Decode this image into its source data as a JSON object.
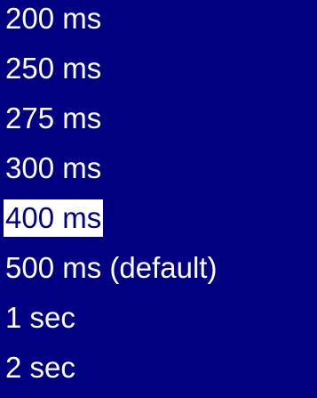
{
  "menu": {
    "colors": {
      "background": "#000080",
      "text": "#ffffff",
      "selected_background": "#ffffff",
      "selected_text": "#000080"
    },
    "selected_value": "400 ms",
    "items": [
      {
        "label": "200 ms"
      },
      {
        "label": "250 ms"
      },
      {
        "label": "275 ms"
      },
      {
        "label": "300 ms"
      },
      {
        "label": "400 ms"
      },
      {
        "label": "500 ms (default)"
      },
      {
        "label": "1 sec"
      },
      {
        "label": "2 sec"
      }
    ]
  }
}
